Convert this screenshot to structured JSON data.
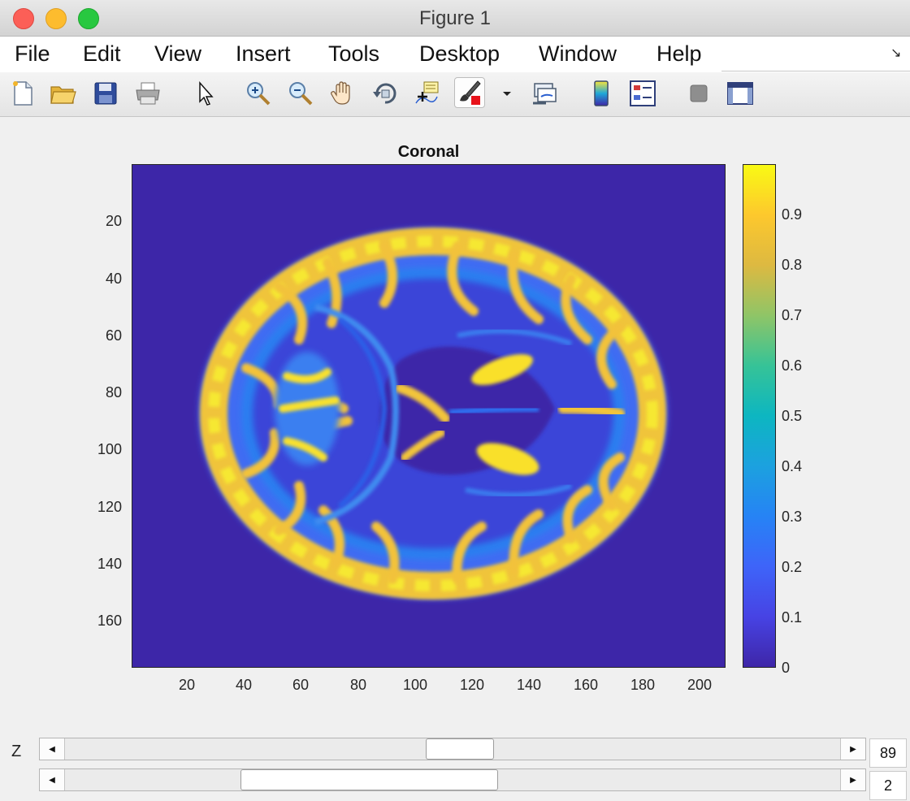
{
  "window": {
    "title": "Figure 1"
  },
  "menu": {
    "items": [
      {
        "label": "File"
      },
      {
        "label": "Edit"
      },
      {
        "label": "View"
      },
      {
        "label": "Insert"
      },
      {
        "label": "Tools"
      },
      {
        "label": "Desktop"
      },
      {
        "label": "Window"
      },
      {
        "label": "Help"
      }
    ]
  },
  "toolbar": {
    "icons": [
      "new-figure-icon",
      "open-file-icon",
      "save-icon",
      "print-icon",
      "edit-plot-cursor-icon",
      "zoom-in-icon",
      "zoom-out-icon",
      "pan-hand-icon",
      "rotate-3d-icon",
      "data-cursor-icon",
      "brush-icon",
      "brush-dropdown-icon",
      "link-plot-icon",
      "colorbar-icon",
      "legend-icon",
      "hide-plot-tools-icon",
      "show-plot-tools-icon"
    ]
  },
  "plot": {
    "title": "Coronal",
    "x_ticks": [
      "20",
      "40",
      "60",
      "80",
      "100",
      "120",
      "140",
      "160",
      "180",
      "200"
    ],
    "y_ticks": [
      "20",
      "40",
      "60",
      "80",
      "100",
      "120",
      "140",
      "160"
    ],
    "colorbar_ticks": [
      "0",
      "0.1",
      "0.2",
      "0.3",
      "0.4",
      "0.5",
      "0.6",
      "0.7",
      "0.8",
      "0.9"
    ],
    "colormap": "parula",
    "background_color": "#3d26a8"
  },
  "controls": {
    "z_label": "Z",
    "z_value": "89",
    "second_value": "2",
    "z_slider_position": 0.51,
    "second_slider_position": 0.34
  }
}
